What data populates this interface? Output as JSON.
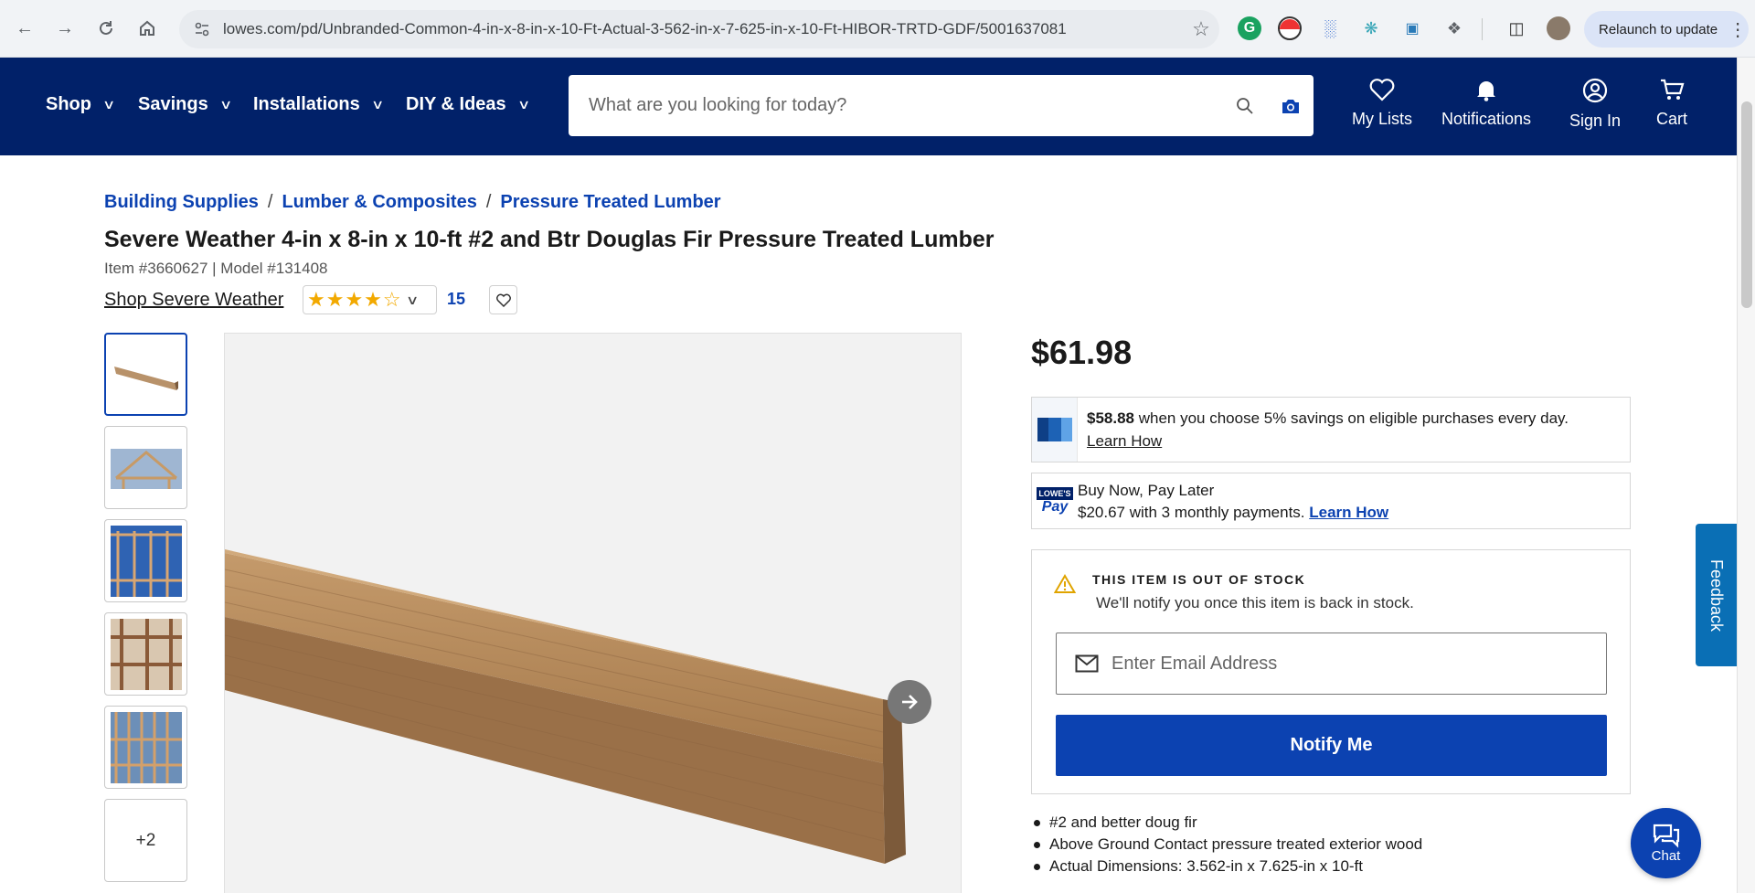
{
  "browser": {
    "url": "lowes.com/pd/Unbranded-Common-4-in-x-8-in-x-10-Ft-Actual-3-562-in-x-7-625-in-x-10-Ft-HIBOR-TRTD-GDF/5001637081",
    "relaunch_label": "Relaunch to update"
  },
  "header": {
    "menu": [
      {
        "label": "Shop"
      },
      {
        "label": "Savings"
      },
      {
        "label": "Installations"
      },
      {
        "label": "DIY & Ideas"
      }
    ],
    "search_placeholder": "What are you looking for today?",
    "links": {
      "my_lists": "My Lists",
      "notifications": "Notifications",
      "sign_in": "Sign In",
      "cart": "Cart"
    }
  },
  "breadcrumb": [
    "Building Supplies",
    "Lumber & Composites",
    "Pressure Treated Lumber"
  ],
  "product": {
    "title": "Severe Weather 4-in x 8-in x 10-ft #2 and Btr Douglas Fir Pressure Treated Lumber",
    "item_line": "Item #3660627 | Model #131408",
    "shop_brand": "Shop Severe Weather",
    "rating": 4,
    "review_count": "15",
    "more_thumbs": "+2",
    "price": "$61.98"
  },
  "savings": {
    "amount": "$58.88",
    "text": " when you choose 5% savings on eligible purchases every day.",
    "link": "Learn How"
  },
  "pay_later": {
    "line1": "Buy Now, Pay Later",
    "line2": "$20.67 with 3 monthly payments. ",
    "link": "Learn How",
    "logo_top": "LOWE'S",
    "logo_bottom": "Pay"
  },
  "stock": {
    "heading": "THIS ITEM IS OUT OF STOCK",
    "subtext": "We'll notify you once this item is back in stock.",
    "email_placeholder": "Enter Email Address",
    "notify_label": "Notify Me"
  },
  "features": [
    "#2 and better doug fir",
    "Above Ground Contact pressure treated exterior wood",
    "Actual Dimensions: 3.562-in x 7.625-in x 10-ft"
  ],
  "feedback_label": "Feedback",
  "chat_label": "Chat",
  "colors": {
    "header_bg": "#012169",
    "link_blue": "#0c42b1",
    "star": "#f2a900"
  }
}
